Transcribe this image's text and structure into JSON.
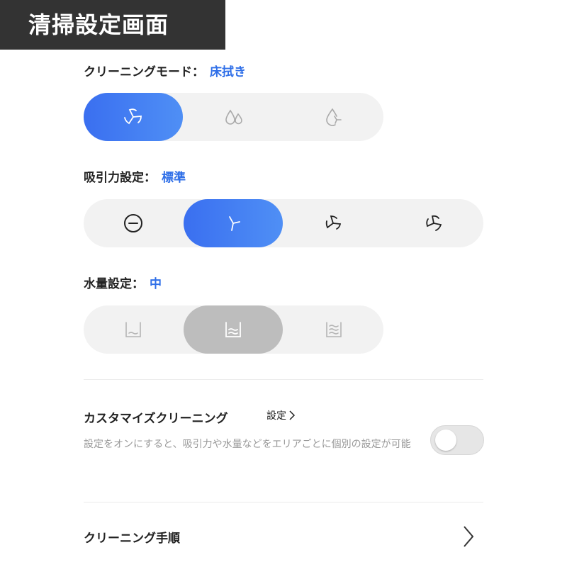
{
  "banner": {
    "title": "清掃設定画面"
  },
  "cleaning_mode": {
    "label": "クリーニングモード：",
    "value": "床拭き",
    "options": [
      {
        "icon": "vacuum-fan-icon",
        "selected": true
      },
      {
        "icon": "water-drops-icon",
        "selected": false
      },
      {
        "icon": "drop-fan-icon",
        "selected": false
      }
    ]
  },
  "suction": {
    "label": "吸引力設定：",
    "value": "標準",
    "options": [
      {
        "icon": "off-minus-icon",
        "selected": false
      },
      {
        "icon": "fan-standard-icon",
        "selected": true
      },
      {
        "icon": "fan-strong-icon",
        "selected": false
      },
      {
        "icon": "fan-max-icon",
        "selected": false
      }
    ]
  },
  "water": {
    "label": "水量設定：",
    "value": "中",
    "options": [
      {
        "icon": "water-low-icon",
        "selected": false
      },
      {
        "icon": "water-medium-icon",
        "selected": true
      },
      {
        "icon": "water-high-icon",
        "selected": false
      }
    ]
  },
  "custom_cleaning": {
    "title": "カスタマイズクリーニング",
    "link_label": "設定",
    "description": "設定をオンにすると、吸引力や水量などをエリアごとに個別の設定が可能",
    "enabled": false
  },
  "cleaning_order": {
    "label": "クリーニング手順"
  },
  "colors": {
    "accent": "#2f6fe8",
    "selected_grey": "#bdbdbd",
    "track": "#f2f2f2"
  }
}
